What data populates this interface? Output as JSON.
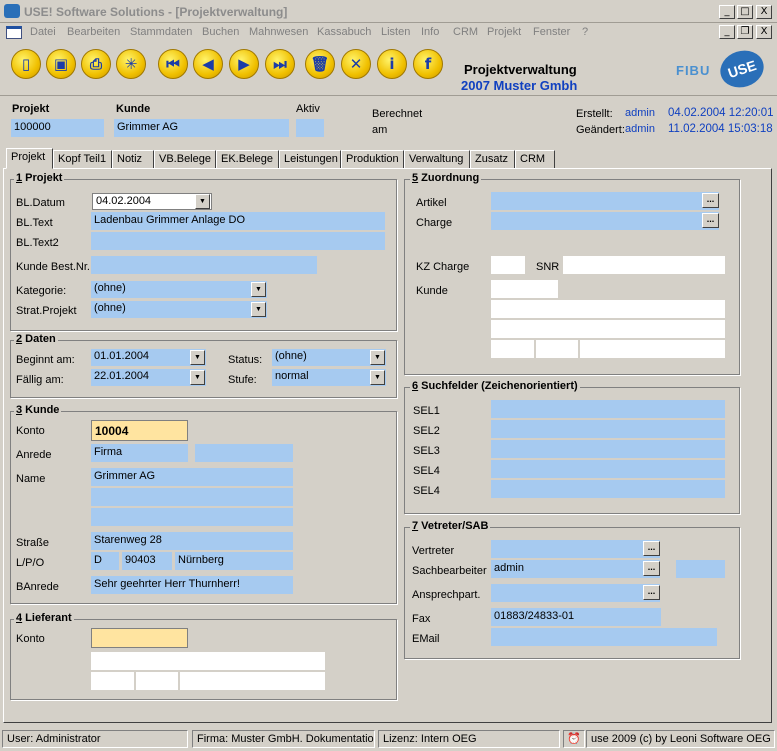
{
  "window": {
    "title": "USE! Software Solutions - [Projektverwaltung]",
    "min": "_",
    "max": "□",
    "close": "X",
    "child_min": "_",
    "child_restore": "❐",
    "child_close": "X"
  },
  "menu": [
    "Datei",
    "Bearbeiten",
    "Stammdaten",
    "Buchen",
    "Mahnwesen",
    "Kassabuch",
    "Listen",
    "Info",
    "CRM",
    "Projekt",
    "Fenster",
    "?"
  ],
  "toolbar": {
    "title": "Projektverwaltung",
    "subtitle": "2007 Muster Gmbh",
    "fibu": "FIBU",
    "logo": "USE",
    "icons": [
      "new-doc-icon",
      "save-icon",
      "print-icon",
      "sprinkler-icon",
      "first-icon",
      "prev-icon",
      "next-icon",
      "last-icon",
      "trash-icon",
      "cancel-icon",
      "info-icon",
      "function-icon"
    ]
  },
  "header": {
    "projekt_label": "Projekt",
    "projekt_value": "100000",
    "kunde_label": "Kunde",
    "kunde_value": "Grimmer AG",
    "aktiv_label": "Aktiv",
    "aktiv_value": "",
    "berechnet_label": "Berechnet",
    "am_label": "am",
    "erstellt_label": "Erstellt:",
    "erstellt_user": "admin",
    "erstellt_date": "04.02.2004 12:20:01",
    "geaendert_label": "Geändert:",
    "geaendert_user": "admin",
    "geaendert_date": "11.02.2004 15:03:18"
  },
  "tabs": [
    "Projekt",
    "Kopf Teil1",
    "Notiz",
    "VB.Belege",
    "EK.Belege",
    "Leistungen",
    "Produktion",
    "Verwaltung",
    "Zusatz",
    "CRM"
  ],
  "g1": {
    "title_num": "1",
    "title": " Projekt",
    "bl_datum_label": "BL.Datum",
    "bl_datum": "04.02.2004",
    "bl_text_label": "BL.Text",
    "bl_text": "Ladenbau Grimmer  Anlage DO",
    "bl_text2_label": "BL.Text2",
    "bl_text2": "",
    "kunde_best_label": "Kunde Best.Nr.",
    "kunde_best": "",
    "kategorie_label": "Kategorie:",
    "kategorie": "(ohne)",
    "strat_label": "Strat.Projekt",
    "strat": "(ohne)"
  },
  "g2": {
    "title_num": "2",
    "title": " Daten",
    "beginnt_label": "Beginnt am:",
    "beginnt": "01.01.2004",
    "faellig_label": "Fällig am:",
    "faellig": "22.01.2004",
    "status_label": "Status:",
    "status": "(ohne)",
    "stufe_label": "Stufe:",
    "stufe": "normal"
  },
  "g3": {
    "title_num": "3",
    "title": " Kunde",
    "konto_label": "Konto",
    "konto": "10004",
    "anrede_label": "Anrede",
    "anrede": "Firma",
    "name_label": "Name",
    "name": "Grimmer AG",
    "strasse_label": "Straße",
    "strasse": "Starenweg 28",
    "lpo_label": "L/P/O",
    "land": "D",
    "plz": "90403",
    "ort": "Nürnberg",
    "banrede_label": "BAnrede",
    "banrede": "Sehr geehrter Herr Thurnherr!"
  },
  "g4": {
    "title_num": "4",
    "title": " Lieferant",
    "konto_label": "Konto"
  },
  "g5": {
    "title_num": "5",
    "title": " Zuordnung",
    "artikel_label": "Artikel",
    "charge_label": "Charge",
    "kz_label": "KZ Charge",
    "snr_label": "SNR",
    "kunde_label": "Kunde"
  },
  "g6": {
    "title_num": "6",
    "title": " Suchfelder (Zeichenorientiert)",
    "sel": [
      "SEL1",
      "SEL2",
      "SEL3",
      "SEL4",
      "SEL4"
    ]
  },
  "g7": {
    "title_num": "7",
    "title": " Vetreter/SAB",
    "vertreter_label": "Vertreter",
    "sachbearbeiter_label": "Sachbearbeiter",
    "sachbearbeiter": "admin",
    "ansprech_label": "Ansprechpart.",
    "fax_label": "Fax",
    "fax": "01883/24833-01",
    "email_label": "EMail"
  },
  "status": {
    "user": "User: Administrator",
    "firma": "Firma: Muster GmbH. Dokumentation",
    "lizenz": "Lizenz: Intern OEG",
    "copyright": "use 2009 (c) by Leoni Software OEG"
  },
  "colors": {
    "field": "#a6caf0",
    "key_field": "#ffe4a0",
    "accent": "#1040c0"
  }
}
